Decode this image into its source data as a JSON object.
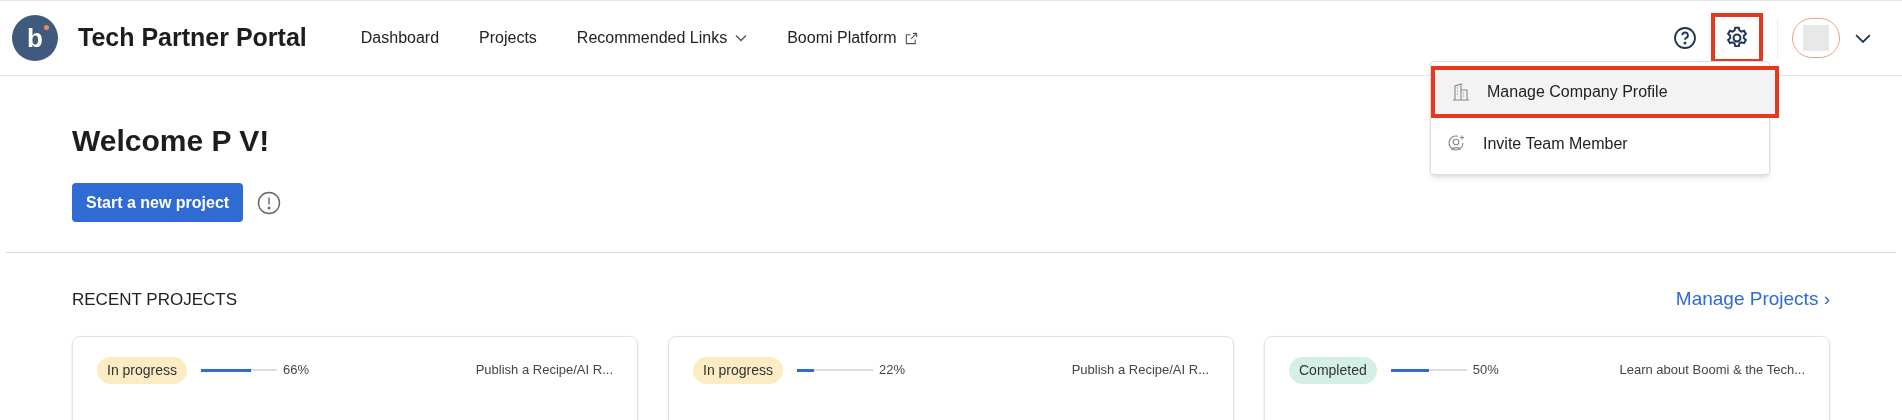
{
  "header": {
    "logo_letter": "b",
    "title": "Tech Partner Portal",
    "nav": [
      {
        "label": "Dashboard",
        "kind": "plain"
      },
      {
        "label": "Projects",
        "kind": "plain"
      },
      {
        "label": "Recommended Links",
        "kind": "dropdown"
      },
      {
        "label": "Boomi Platform",
        "kind": "external"
      }
    ],
    "settings_highlighted": true
  },
  "settings_menu": {
    "items": [
      {
        "label": "Manage Company Profile",
        "kind": "building",
        "selected": true,
        "highlighted": true
      },
      {
        "label": "Invite Team Member",
        "kind": "invite",
        "selected": false,
        "highlighted": false
      }
    ]
  },
  "welcome": {
    "title": "Welcome P V!",
    "button": "Start a new project"
  },
  "recent_projects": {
    "title": "RECENT PROJECTS",
    "link": "Manage Projects ›",
    "cards": [
      {
        "status": "In progress",
        "kind": "progress",
        "level": 0.66,
        "percent": "66%",
        "name": "Publish a Recipe/AI R..."
      },
      {
        "status": "In progress",
        "kind": "progress",
        "level": 0.22,
        "percent": "22%",
        "name": "Publish a Recipe/AI R..."
      },
      {
        "status": "Completed",
        "kind": "done",
        "level": 0.5,
        "percent": "50%",
        "name": "Learn about Boomi & the Tech..."
      }
    ]
  }
}
